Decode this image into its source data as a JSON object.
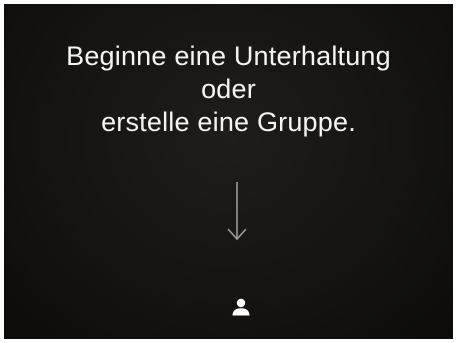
{
  "empty_state": {
    "line1": "Beginne eine Unterhaltung",
    "line2": "oder",
    "line3": "erstelle eine Gruppe."
  },
  "icons": {
    "hint_arrow": "arrow-down-icon",
    "action": "person-icon"
  },
  "colors": {
    "background": "#141311",
    "text": "#f4f4f4",
    "arrow": "#9a9a9a",
    "icon": "#ffffff"
  }
}
